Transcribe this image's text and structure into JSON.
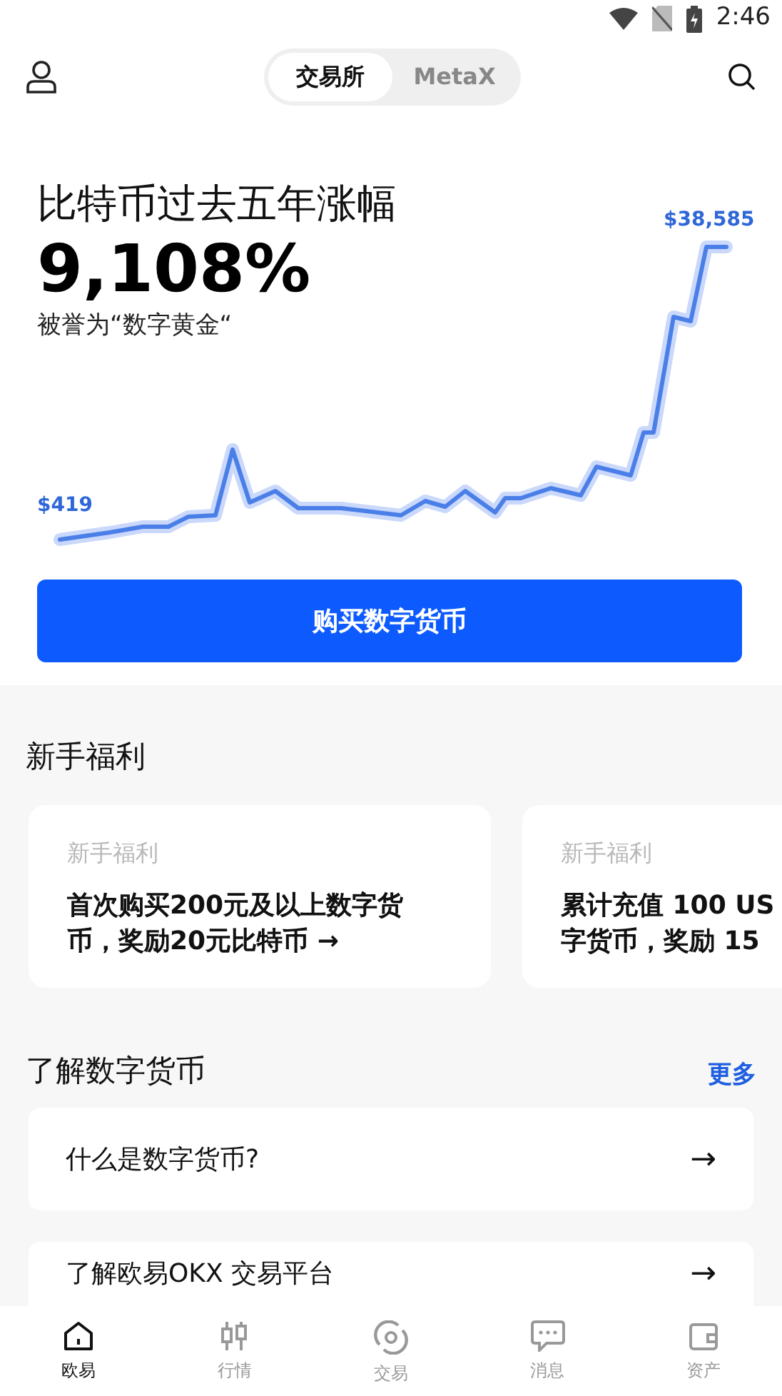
{
  "status_bar": {
    "time": "2:46"
  },
  "header": {
    "segments": [
      {
        "label": "交易所",
        "selected": true
      },
      {
        "label": "MetaX",
        "selected": false
      }
    ]
  },
  "hero": {
    "title": "比特币过去五年涨幅",
    "gain": "9,108%",
    "subtitle": "被誉为“数字黄金“",
    "start_label": "$419",
    "end_label": "$38,585",
    "button": "购买数字货币"
  },
  "welfare": {
    "title": "新手福利",
    "cards": [
      {
        "tag": "新手福利",
        "lines": [
          "首次购买200元及以上数字货",
          "币，奖励20元比特币 →"
        ]
      },
      {
        "tag": "新手福利",
        "lines": [
          "累计充值 100 US",
          "字货币，奖励 15"
        ]
      }
    ]
  },
  "learn": {
    "title": "了解数字货币",
    "more": "更多",
    "items": [
      {
        "text": "什么是数字货币?",
        "arrow": "→"
      },
      {
        "text": "了解欧易OKX 交易平台",
        "arrow": "→"
      }
    ]
  },
  "bottom_nav": [
    {
      "label": "欧易",
      "selected": true
    },
    {
      "label": "行情",
      "selected": false
    },
    {
      "label": "交易",
      "selected": false
    },
    {
      "label": "消息",
      "selected": false
    },
    {
      "label": "资产",
      "selected": false
    }
  ]
}
